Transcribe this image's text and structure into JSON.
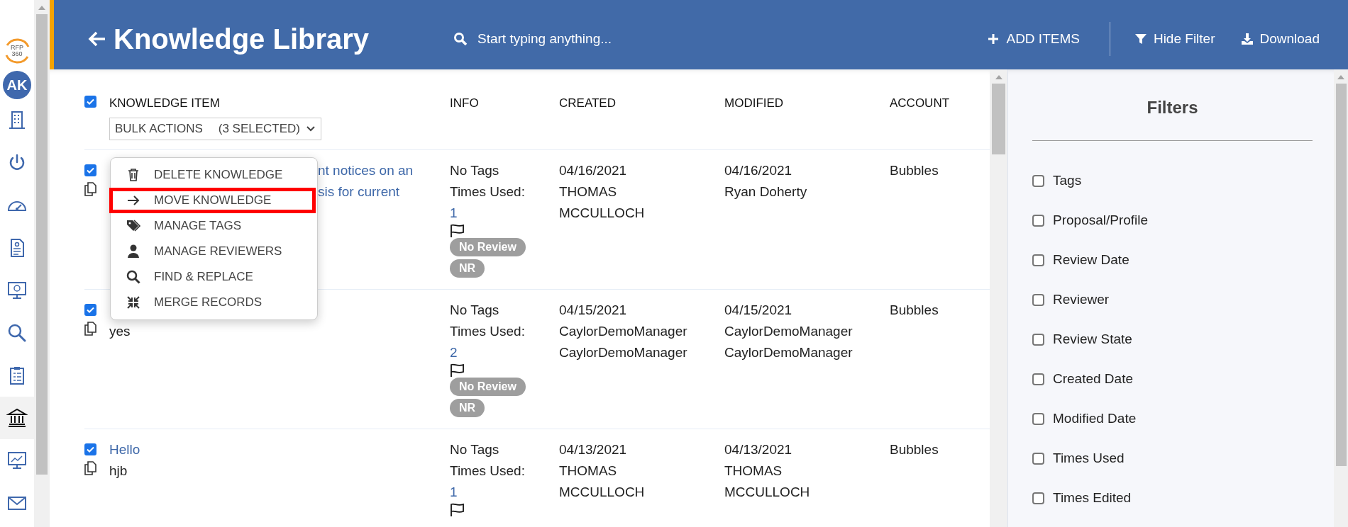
{
  "sidebar": {
    "logo": [
      "RFP",
      "360"
    ],
    "avatar": "AK",
    "items": [
      {
        "selected": false
      },
      {
        "selected": false
      },
      {
        "selected": false
      },
      {
        "selected": false
      },
      {
        "selected": false
      },
      {
        "selected": false
      },
      {
        "selected": false
      },
      {
        "selected": true
      },
      {
        "selected": false
      },
      {
        "selected": false
      }
    ]
  },
  "header": {
    "title": "Knowledge Library",
    "search": {
      "placeholder": "Start typing anything..."
    },
    "actions": [
      {
        "kind": "add",
        "label": "ADD ITEMS"
      },
      {
        "kind": "filter",
        "label": "Hide Filter"
      },
      {
        "kind": "download",
        "label": "Download"
      }
    ]
  },
  "table": {
    "select_all": true,
    "columns": [
      "KNOWLEDGE ITEM",
      "INFO",
      "CREATED",
      "MODIFIED",
      "ACCOUNT"
    ],
    "bulk_actions": {
      "label": "BULK ACTIONS",
      "count": "(3 SELECTED)",
      "expanded": true,
      "items": [
        {
          "kind": "delete",
          "label": "DELETE KNOWLEDGE",
          "selected": false
        },
        {
          "kind": "move",
          "label": "MOVE KNOWLEDGE",
          "selected": true
        },
        {
          "kind": "tags",
          "label": "MANAGE TAGS",
          "selected": false
        },
        {
          "kind": "reviewers",
          "label": "MANAGE REVIEWERS",
          "selected": false
        },
        {
          "kind": "find",
          "label": "FIND & REPLACE",
          "selected": false
        },
        {
          "kind": "merge",
          "label": "MERGE RECORDS",
          "selected": false
        }
      ]
    },
    "rows": [
      {
        "checked": true,
        "title": [
          "nt notices on an",
          "sis for current"
        ],
        "info": {
          "tags": "No Tags",
          "times_used_label": "Times Used:",
          "times_used": "1",
          "badges": [
            "No Review",
            "NR"
          ]
        },
        "created": [
          "04/16/2021",
          "THOMAS",
          "MCCULLOCH"
        ],
        "modified": [
          "04/16/2021",
          "Ryan Doherty"
        ],
        "account": "Bubbles"
      },
      {
        "checked": true,
        "body": "yes",
        "info": {
          "tags": "No Tags",
          "times_used_label": "Times Used:",
          "times_used": "2",
          "badges": [
            "No Review",
            "NR"
          ]
        },
        "created": [
          "04/15/2021",
          "CaylorDemoManager",
          "CaylorDemoManager"
        ],
        "modified": [
          "04/15/2021",
          "CaylorDemoManager",
          "CaylorDemoManager"
        ],
        "account": "Bubbles"
      },
      {
        "checked": true,
        "title": [
          "Hello"
        ],
        "body": "hjb",
        "info": {
          "tags": "No Tags",
          "times_used_label": "Times Used:",
          "times_used": "1"
        },
        "created": [
          "04/13/2021",
          "THOMAS",
          "MCCULLOCH"
        ],
        "modified": [
          "04/13/2021",
          "THOMAS",
          "MCCULLOCH"
        ],
        "account": "Bubbles"
      }
    ]
  },
  "filters": {
    "title": "Filters",
    "items": [
      {
        "label": "Tags",
        "checked": false
      },
      {
        "label": "Proposal/Profile",
        "checked": false
      },
      {
        "label": "Review Date",
        "checked": false
      },
      {
        "label": "Reviewer",
        "checked": false
      },
      {
        "label": "Review State",
        "checked": false
      },
      {
        "label": "Created Date",
        "checked": false
      },
      {
        "label": "Modified Date",
        "checked": false
      },
      {
        "label": "Times Used",
        "checked": false
      },
      {
        "label": "Times Edited",
        "checked": false
      }
    ]
  }
}
